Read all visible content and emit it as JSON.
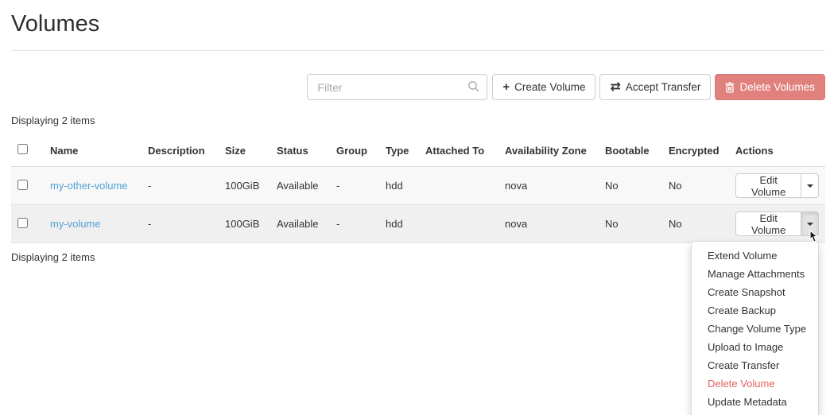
{
  "page": {
    "title": "Volumes"
  },
  "toolbar": {
    "filter_placeholder": "Filter",
    "create_volume_label": "Create Volume",
    "accept_transfer_label": "Accept Transfer",
    "delete_volumes_label": "Delete Volumes",
    "plus_glyph": "+",
    "transfer_glyph": "⇄"
  },
  "table": {
    "summary_top": "Displaying 2 items",
    "summary_bottom": "Displaying 2 items",
    "columns": [
      "Name",
      "Description",
      "Size",
      "Status",
      "Group",
      "Type",
      "Attached To",
      "Availability Zone",
      "Bootable",
      "Encrypted",
      "Actions"
    ],
    "rows": [
      {
        "name": "my-other-volume",
        "description": "-",
        "size": "100GiB",
        "status": "Available",
        "group": "-",
        "type": "hdd",
        "attached_to": "",
        "availability_zone": "nova",
        "bootable": "No",
        "encrypted": "No",
        "action_label": "Edit Volume"
      },
      {
        "name": "my-volume",
        "description": "-",
        "size": "100GiB",
        "status": "Available",
        "group": "-",
        "type": "hdd",
        "attached_to": "",
        "availability_zone": "nova",
        "bootable": "No",
        "encrypted": "No",
        "action_label": "Edit Volume"
      }
    ]
  },
  "dropdown": {
    "items": [
      {
        "label": "Extend Volume",
        "danger": false
      },
      {
        "label": "Manage Attachments",
        "danger": false
      },
      {
        "label": "Create Snapshot",
        "danger": false
      },
      {
        "label": "Create Backup",
        "danger": false
      },
      {
        "label": "Change Volume Type",
        "danger": false
      },
      {
        "label": "Upload to Image",
        "danger": false
      },
      {
        "label": "Create Transfer",
        "danger": false
      },
      {
        "label": "Delete Volume",
        "danger": true
      },
      {
        "label": "Update Metadata",
        "danger": false
      }
    ]
  },
  "colors": {
    "link": "#51a0d4",
    "danger_button_bg": "#e0817e",
    "danger_text": "#e2625e",
    "row1_bg": "#f8f8f9",
    "row2_bg": "#f0f0f1"
  }
}
